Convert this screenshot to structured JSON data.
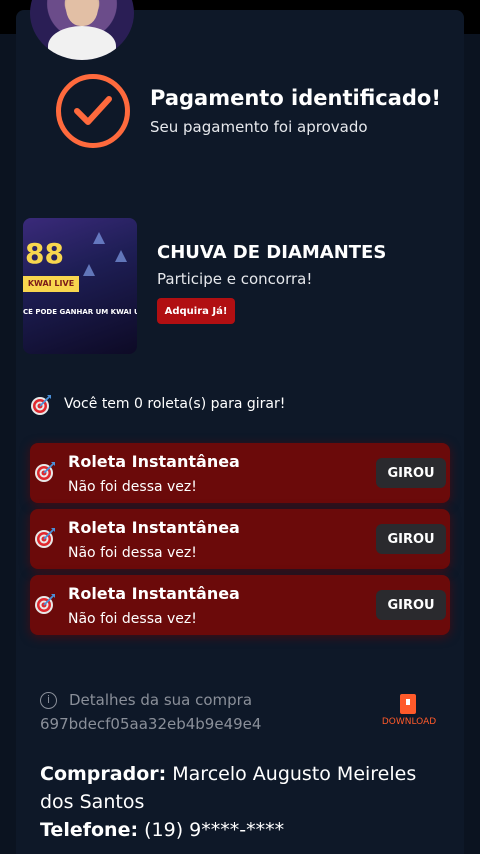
{
  "payment": {
    "title": "Pagamento identificado!",
    "subtitle": "Seu pagamento foi aprovado"
  },
  "promo": {
    "title": "CHUVA DE DIAMANTES",
    "subtitle": "Participe e concorra!",
    "button_label": "Adquira Já!",
    "image_text": {
      "badge": "88",
      "kwai_label": "KWAI LIVE",
      "banner": "CÊ PODE GANHAR UM KWAI UNIVER"
    }
  },
  "roulette": {
    "count_text": "Você tem 0 roleta(s) para girar!",
    "items": [
      {
        "title": "Roleta Instantânea",
        "subtitle": "Não foi dessa vez!",
        "button_label": "GIROU"
      },
      {
        "title": "Roleta Instantânea",
        "subtitle": "Não foi dessa vez!",
        "button_label": "GIROU"
      },
      {
        "title": "Roleta Instantânea",
        "subtitle": "Não foi dessa vez!",
        "button_label": "GIROU"
      }
    ]
  },
  "details": {
    "label": "Detalhes da sua compra",
    "order_id": "697bdecf05aa32eb4b9e49e4",
    "download_label": "DOWNLOAD"
  },
  "buyer": {
    "name_label": "Comprador:",
    "name_value": "Marcelo Augusto Meireles dos Santos",
    "phone_label": "Telefone:",
    "phone_value": "(19) 9****-****"
  },
  "colors": {
    "background": "#0b1320",
    "card": "#0e1828",
    "accent_orange": "#ff6a3d",
    "roulette_red": "#6b0a0a",
    "button_red": "#b10f12"
  },
  "icons": {
    "success": "check-circle-icon",
    "roulette": "target-icon",
    "info": "info-icon",
    "download": "pdf-file-icon"
  }
}
